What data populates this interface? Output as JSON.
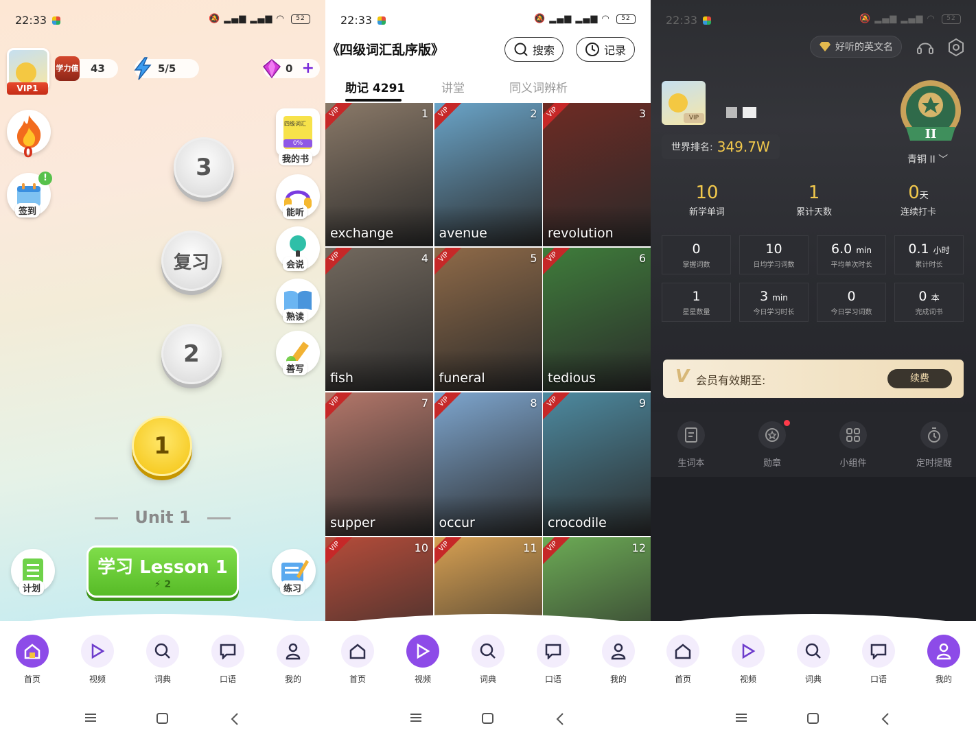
{
  "status": {
    "time": "22:33",
    "battery": "52"
  },
  "nav": [
    {
      "label": "首页"
    },
    {
      "label": "视频"
    },
    {
      "label": "词典"
    },
    {
      "label": "口语"
    },
    {
      "label": "我的"
    }
  ],
  "home": {
    "vip_label": "VIP1",
    "xueli_label": "学力值",
    "xueli_value": "43",
    "energy_value": "5/5",
    "gem_value": "0",
    "streak_value": "0",
    "checkin_label": "签到",
    "side_menu": [
      {
        "label": "我的书",
        "sub": "0%",
        "cover": "四级词汇"
      },
      {
        "label": "能听"
      },
      {
        "label": "会说"
      },
      {
        "label": "熟读"
      },
      {
        "label": "善写"
      }
    ],
    "lesson_nodes": [
      "3",
      "复习",
      "2",
      "1"
    ],
    "unit_title": "Unit 1",
    "study_button": "学习 Lesson 1",
    "study_energy": "2",
    "plan_label": "计划",
    "practice_label": "练习"
  },
  "video": {
    "title": "《四级词汇乱序版》",
    "search_label": "搜索",
    "record_label": "记录",
    "tabs": [
      "助记 4291",
      "讲堂",
      "同义词辨析"
    ],
    "cards": [
      {
        "num": "1",
        "word": "exchange",
        "vip": "VIP",
        "color": "#8a7968"
      },
      {
        "num": "2",
        "word": "avenue",
        "vip": "VIP",
        "color": "#6aa4c8"
      },
      {
        "num": "3",
        "word": "revolution",
        "vip": "VIP",
        "color": "#6e2b24"
      },
      {
        "num": "4",
        "word": "fish",
        "vip": "VIP",
        "color": "#73695e"
      },
      {
        "num": "5",
        "word": "funeral",
        "vip": "VIP",
        "color": "#8f6a48"
      },
      {
        "num": "6",
        "word": "tedious",
        "vip": "VIP",
        "color": "#3f7d3b"
      },
      {
        "num": "7",
        "word": "supper",
        "vip": "VIP",
        "color": "#b4776a"
      },
      {
        "num": "8",
        "word": "occur",
        "vip": "VIP",
        "color": "#7ea6cf"
      },
      {
        "num": "9",
        "word": "crocodile",
        "vip": "VIP",
        "color": "#4d8aa0"
      },
      {
        "num": "10",
        "word": "",
        "vip": "VIP",
        "color": "#b54c3a"
      },
      {
        "num": "11",
        "word": "",
        "vip": "VIP",
        "color": "#d7a052"
      },
      {
        "num": "12",
        "word": "",
        "vip": "VIP",
        "color": "#6cab55"
      }
    ]
  },
  "profile": {
    "english_name_pill": "好听的英文名",
    "vip_label": "VIP",
    "rank_label": "世界排名:",
    "rank_value": "349.7W",
    "medal_roman": "II",
    "medal_label": "青铜 II",
    "big_stats": [
      {
        "value": "10",
        "unit": "",
        "label": "新学单词"
      },
      {
        "value": "1",
        "unit": "",
        "label": "累计天数"
      },
      {
        "value": "0",
        "unit": "天",
        "label": "连续打卡"
      }
    ],
    "grid_stats": [
      {
        "value": "0",
        "unit": "",
        "label": "掌握词数"
      },
      {
        "value": "10",
        "unit": "",
        "label": "日均学习词数"
      },
      {
        "value": "6.0",
        "unit": "min",
        "label": "平均单次时长"
      },
      {
        "value": "0.1",
        "unit": "小时",
        "label": "累计时长"
      },
      {
        "value": "1",
        "unit": "",
        "label": "星星数量"
      },
      {
        "value": "3",
        "unit": "min",
        "label": "今日学习时长"
      },
      {
        "value": "0",
        "unit": "",
        "label": "今日学习词数"
      },
      {
        "value": "0",
        "unit": "本",
        "label": "完成词书"
      }
    ],
    "member_text": "会员有效期至:",
    "renew_label": "续费",
    "tools": [
      {
        "label": "生词本"
      },
      {
        "label": "勋章"
      },
      {
        "label": "小组件"
      },
      {
        "label": "定时提醒"
      }
    ]
  }
}
